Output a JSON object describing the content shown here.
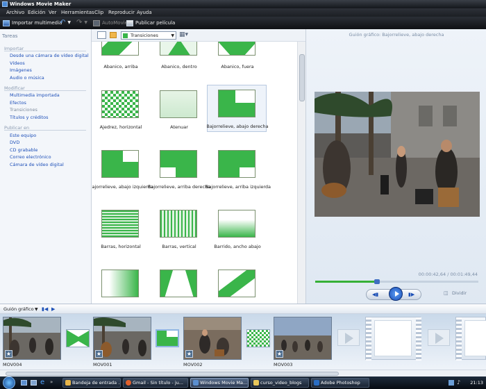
{
  "window": {
    "title": "Windows Movie Maker"
  },
  "menu": [
    "Archivo",
    "Edición",
    "Ver",
    "Herramientas",
    "Clip",
    "Reproducir",
    "Ayuda"
  ],
  "toolbar": {
    "import_label": "Importar multimedia",
    "automovie_label": "AutoMovie",
    "publish_label": "Publicar película",
    "collection_select": "Transiciones"
  },
  "tasks": {
    "header": "Tareas",
    "sections": [
      {
        "title": "Importar",
        "items": [
          "Desde una cámara de vídeo digital",
          "Vídeos",
          "Imágenes",
          "Audio o música"
        ]
      },
      {
        "title": "Modificar",
        "items": [
          "Multimedia importada",
          "Efectos",
          "Transiciones",
          "Títulos y créditos"
        ]
      },
      {
        "title": "Publicar en",
        "items": [
          "Este equipo",
          "DVD",
          "CD grabable",
          "Correo electrónico",
          "Cámara de vídeo digital"
        ]
      }
    ]
  },
  "transitions": [
    "Abanico, arriba",
    "Abanico, dentro",
    "Abanico, fuera",
    "Ajedrez, horizontal",
    "Atenuar",
    "Bajorrelieve, abajo derecha",
    "Bajorrelieve, abajo izquierda",
    "Bajorrelieve, arriba derecha",
    "Bajorrelieve, arriba izquierda",
    "Barras, horizontal",
    "Barras, vertical",
    "Barrido, ancho abajo",
    "",
    "",
    ""
  ],
  "preview": {
    "title": "Guión gráfico: Bajorrelieve, abajo derecha",
    "time": "00:00:42,64 / 00:01:49,44",
    "progress": 0.38,
    "split_label": "Dividir"
  },
  "storyboard": {
    "label": "Guión gráfico",
    "clips": [
      "MOV004",
      "MOV001",
      "MOV002",
      "MOV003"
    ]
  },
  "taskbar": {
    "tasks": [
      "Bandeja de entrada ...",
      "Gmail - Sin título - ju...",
      "Windows Movie Ma...",
      "curso_video_blogs",
      "Adobe Photoshop"
    ],
    "clock": "21:13"
  },
  "colors": {
    "accent": "#3ab54a",
    "link": "#1d4fb8"
  }
}
